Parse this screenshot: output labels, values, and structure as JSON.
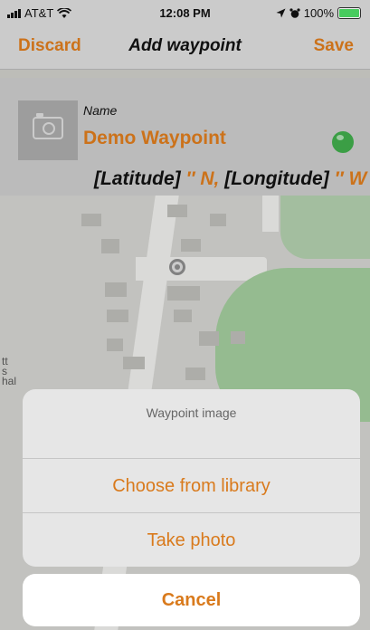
{
  "status_bar": {
    "carrier": "AT&T",
    "time": "12:08 PM",
    "battery": "100%",
    "battery_level": 1.0,
    "icons": [
      "signal-bars-icon",
      "wifi-icon",
      "location-arrow-icon",
      "alarm-icon",
      "battery-charging-icon"
    ]
  },
  "nav": {
    "discard_label": "Discard",
    "title": "Add waypoint",
    "save_label": "Save"
  },
  "waypoint": {
    "name_label": "Name",
    "name_value": "Demo Waypoint",
    "status_color": "#3fa84a",
    "latitude_label": "[Latitude]",
    "latitude_suffix": "″ N,",
    "longitude_label": "[Longitude]",
    "longitude_suffix": "″ W"
  },
  "map": {
    "label_lines": [
      "tt",
      "s",
      "hal"
    ]
  },
  "action_sheet": {
    "title": "Waypoint image",
    "options": [
      {
        "label": "Choose from library"
      },
      {
        "label": "Take photo"
      }
    ],
    "cancel_label": "Cancel"
  },
  "colors": {
    "accent": "#d97a1c",
    "chrome": "#d8d8d8"
  }
}
